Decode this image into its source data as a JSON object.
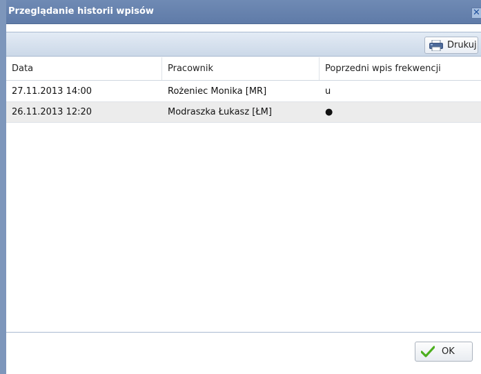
{
  "window": {
    "title": "Przeglądanie historii wpisów",
    "close_glyph": "✕"
  },
  "toolbar": {
    "print_label": "Drukuj",
    "print_icon": "printer-icon"
  },
  "table": {
    "columns": [
      "Data",
      "Pracownik",
      "Poprzedni wpis frekwencji"
    ],
    "rows": [
      [
        "27.11.2013 14:00",
        "Rożeniec Monika [MR]",
        "u"
      ],
      [
        "26.11.2013 12:20",
        "Modraszka Łukasz [ŁM]",
        "●"
      ]
    ]
  },
  "footer": {
    "ok_label": "OK",
    "ok_icon": "checkmark-icon"
  },
  "colors": {
    "titlebar": "#6f8ab4",
    "border": "#7d96bb",
    "toolbar": "#d6e1ee",
    "alt_row": "#ececec",
    "checkmark": "#4caf1e"
  }
}
